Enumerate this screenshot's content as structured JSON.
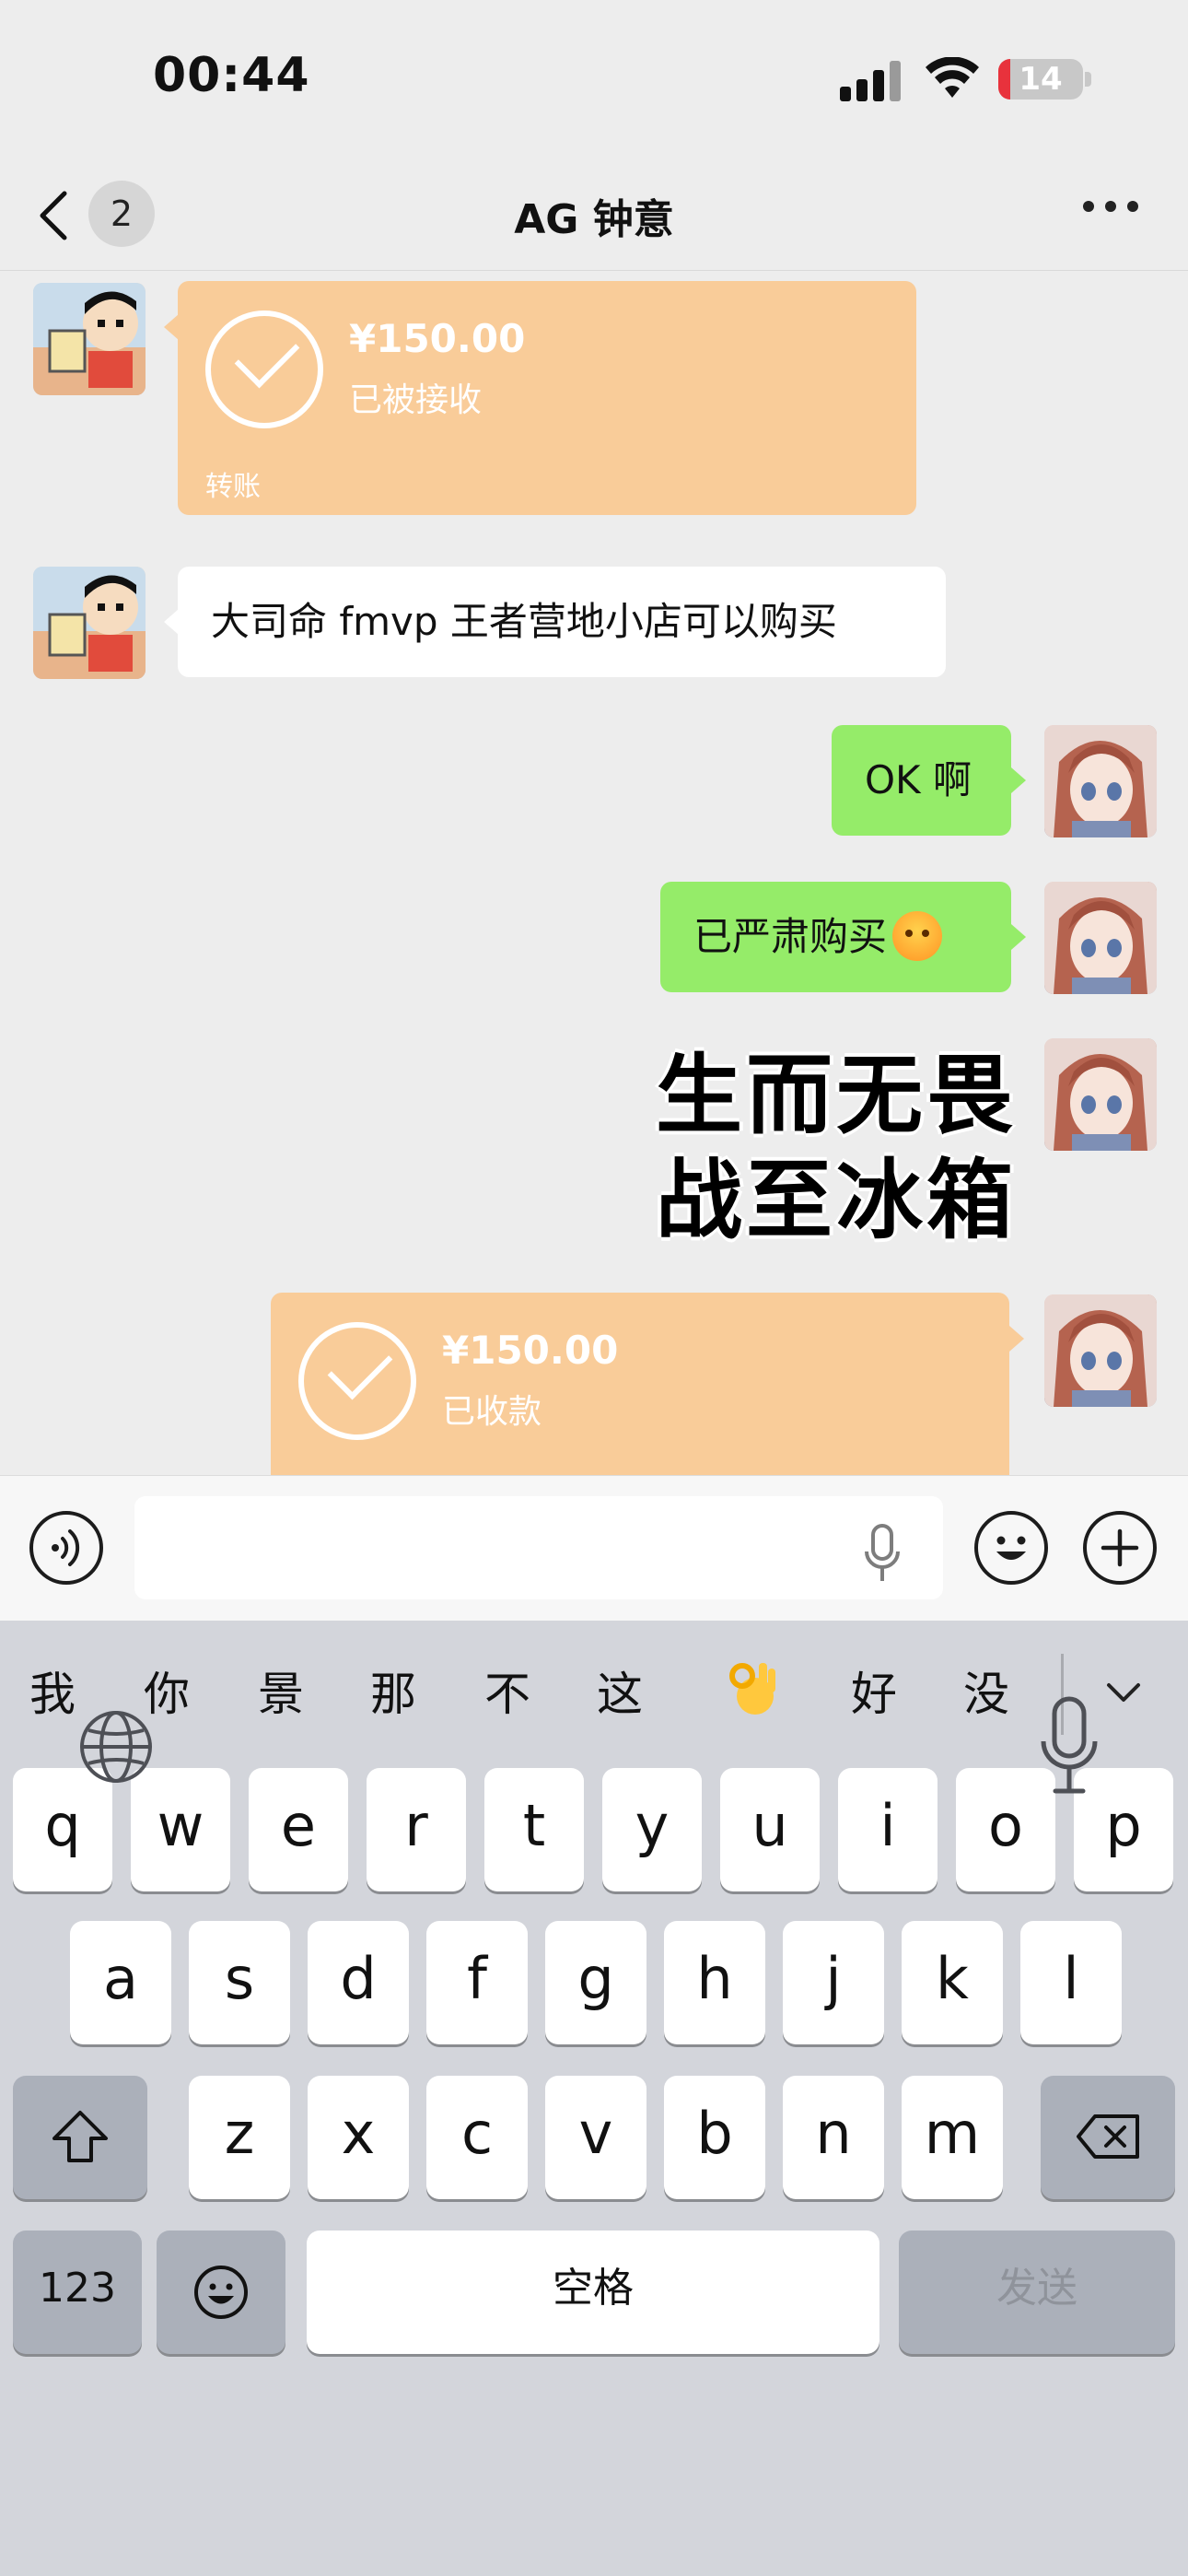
{
  "status_bar": {
    "time": "00:44",
    "battery_percent": "14",
    "battery_fill": 0.14,
    "battery_color": "#e8323c"
  },
  "nav": {
    "back_icon": "chevron-left-icon",
    "unread_badge": "2",
    "title": "AG 钟意",
    "more_icon": "ellipsis-icon"
  },
  "messages": [
    {
      "side": "left",
      "type": "transfer",
      "amount": "¥150.00",
      "status": "已被接收",
      "label": "转账"
    },
    {
      "side": "left",
      "type": "text",
      "text": "大司命 fmvp  王者营地小店可以购买"
    },
    {
      "side": "right",
      "type": "text",
      "text": "OK 啊"
    },
    {
      "side": "right",
      "type": "text",
      "text": "已严肃购买",
      "emoji": "angry-face-emoji"
    },
    {
      "side": "right",
      "type": "sticker",
      "lines": [
        "生而无畏",
        "战至冰箱"
      ]
    },
    {
      "side": "right",
      "type": "transfer",
      "amount": "¥150.00",
      "status": "已收款"
    }
  ],
  "input_bar": {
    "voice_icon": "voice-icon",
    "placeholder": "",
    "mic_icon": "microphone-icon",
    "emoji_icon": "smiley-icon",
    "plus_icon": "plus-icon"
  },
  "keyboard": {
    "candidates": [
      "我",
      "你",
      "景",
      "那",
      "不",
      "这",
      "好",
      "没"
    ],
    "candidate_emoji": "ok-hand-emoji",
    "row1": [
      "q",
      "w",
      "e",
      "r",
      "t",
      "y",
      "u",
      "i",
      "o",
      "p"
    ],
    "row2": [
      "a",
      "s",
      "d",
      "f",
      "g",
      "h",
      "j",
      "k",
      "l"
    ],
    "row3": [
      "z",
      "x",
      "c",
      "v",
      "b",
      "n",
      "m"
    ],
    "numbers_key": "123",
    "space_key": "空格",
    "send_key": "发送"
  },
  "colors": {
    "chat_background": "#ededed",
    "transfer_orange": "#f9cc99",
    "bubble_green": "#95ec69",
    "keyboard_background": "#d3d5db"
  }
}
